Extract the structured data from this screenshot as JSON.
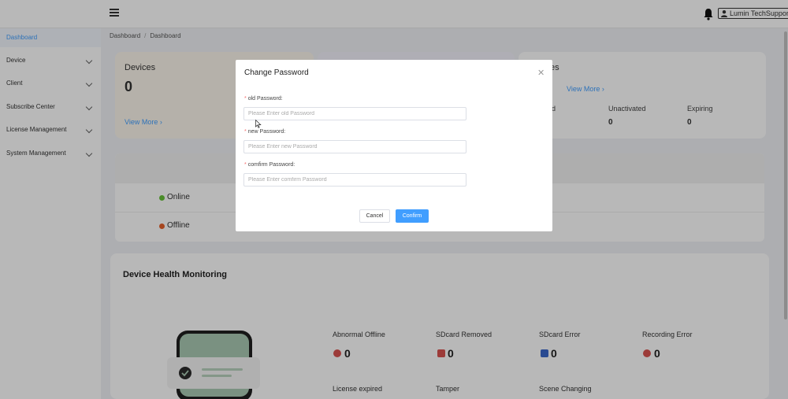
{
  "header": {
    "user_label": "Lumin TechSupport"
  },
  "sidebar": {
    "items": [
      {
        "label": "Dashboard"
      },
      {
        "label": "Device"
      },
      {
        "label": "Client"
      },
      {
        "label": "Subscribe Center"
      },
      {
        "label": "License Management"
      },
      {
        "label": "System Management"
      }
    ]
  },
  "breadcrumb": [
    "Dashboard",
    "Dashboard"
  ],
  "cards": {
    "devices": {
      "title": "Devices",
      "count": "0",
      "link": "View More"
    },
    "licenses": {
      "title_fragment": "es",
      "link": "View More",
      "stats": [
        {
          "label": "d",
          "value": ""
        },
        {
          "label": "Unactivated",
          "value": "0"
        },
        {
          "label": "Expiring",
          "value": "0"
        }
      ]
    }
  },
  "status": {
    "online_label": "Online",
    "offline_label": "Offline"
  },
  "health": {
    "title": "Device Health Monitoring",
    "metrics": [
      {
        "label": "Abnormal Offline",
        "value": "0"
      },
      {
        "label": "SDcard Removed",
        "value": "0"
      },
      {
        "label": "SDcard Error",
        "value": "0"
      },
      {
        "label": "Recording Error",
        "value": "0"
      }
    ],
    "metrics_row2": [
      "License expired",
      "Tamper",
      "Scene Changing"
    ]
  },
  "modal": {
    "title": "Change Password",
    "fields": [
      {
        "label": "old Password:",
        "placeholder": "Please Enter old Password"
      },
      {
        "label": "new Password:",
        "placeholder": "Please Enter new Password"
      },
      {
        "label": "comfirm Password:",
        "placeholder": "Please Enter comfirm Password"
      }
    ],
    "cancel_label": "Cancel",
    "confirm_label": "Confirm"
  },
  "colors": {
    "accent": "#409eff",
    "online": "#67c23a",
    "offline": "#e6622c",
    "required": "#f56c6c"
  }
}
